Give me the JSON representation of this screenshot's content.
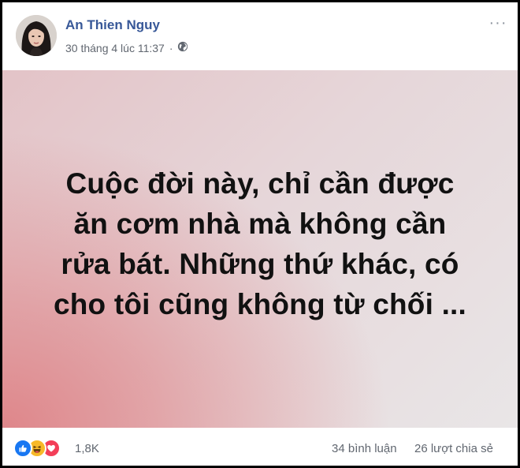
{
  "post": {
    "author": "An Thien Nguy",
    "timestamp": "30 tháng 4 lúc 11:37",
    "separator": "·",
    "privacy_icon": "globe-icon",
    "menu_icon": "more-horizontal-icon",
    "menu_label": "···",
    "text_lines": [
      "Cuộc đời này, chỉ cần được",
      "ăn cơm nhà mà không cần",
      "rửa bát. Những thứ khác, có",
      "cho tôi cũng không từ chối ..."
    ],
    "background_colors": [
      "#de8286",
      "#e9e6e7"
    ]
  },
  "footer": {
    "reaction_icons": [
      "like-icon",
      "haha-icon",
      "love-icon"
    ],
    "reaction_count": "1,8K",
    "comments": "34 bình luận",
    "shares": "26 lượt chia sẻ"
  },
  "colors": {
    "author_link": "#385898",
    "meta_text": "#616770",
    "like": "#1877f2",
    "haha": "#f7b928",
    "love": "#f33e58"
  }
}
